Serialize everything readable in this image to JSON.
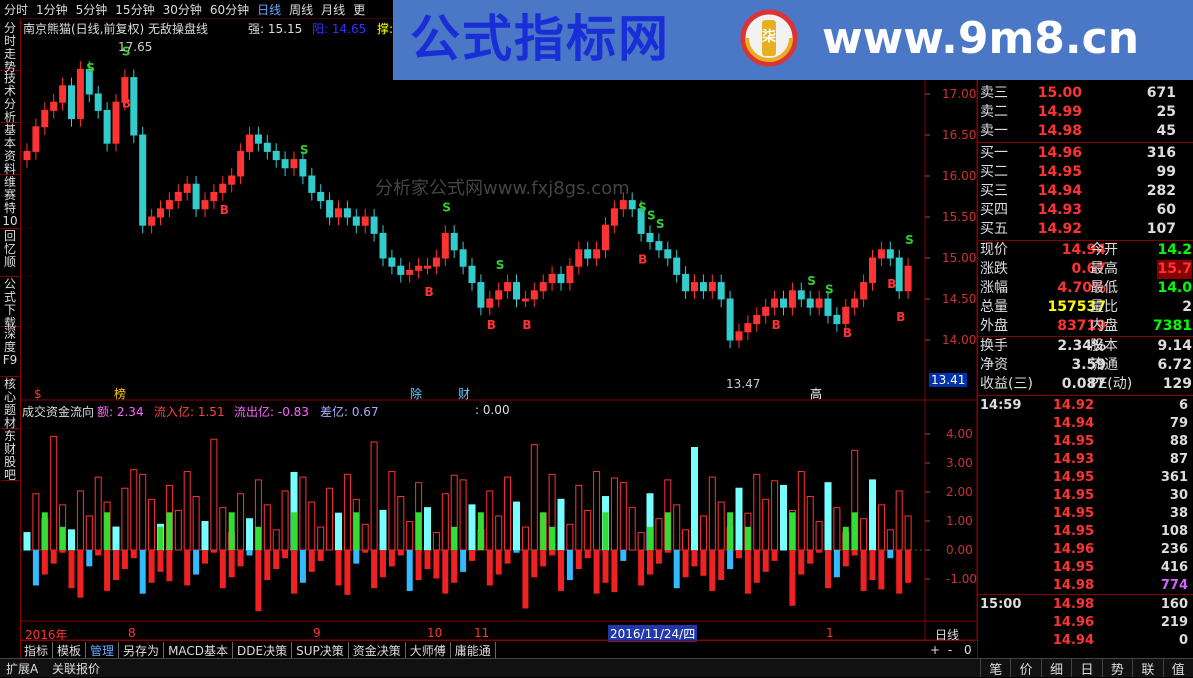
{
  "topbar": {
    "items": [
      "分时",
      "1分钟",
      "5分钟",
      "15分钟",
      "30分钟",
      "60分钟",
      "日线",
      "周线",
      "月线",
      "更"
    ],
    "active": "日线"
  },
  "lefttabs": [
    "分时走势",
    "技术分析",
    "基本资料",
    "维赛特10",
    "回忆顺",
    "公式下载",
    "深度F9",
    "核心题材",
    "东财股吧"
  ],
  "banner": {
    "left": "公式指标网",
    "right": "www.9m8.cn",
    "logo_char": "柒"
  },
  "watermark": {
    "text": "分析家公式网www.fxj8gs.com"
  },
  "chart": {
    "title": "南京熊猫(日线,前复权) 无敌操盘线",
    "legend_strong": "强: 15.15",
    "legend_yang": "阳: 14.65",
    "legend_support": "撑:",
    "price_axis": [
      "17.00",
      "16.50",
      "16.00",
      "15.50",
      "15.00",
      "14.50",
      "14.00"
    ],
    "cur_price": "13.41",
    "high_label": "17.65",
    "low_label": "13.47",
    "markers": {
      "s_label": "S",
      "b_label": "B"
    },
    "event_tags": [
      "$",
      "榜",
      "除",
      "财",
      "高"
    ],
    "sub_title": "成交资金流向",
    "sub_legend": {
      "e": "额: 2.34",
      "in": "流入亿: 1.51",
      "out": "流出亿: -0.83",
      "diff": "差亿: 0.67",
      "zero": ": 0.00"
    },
    "sub_axis": [
      "4.00",
      "3.00",
      "2.00",
      "1.00",
      "0.00",
      "-1.00"
    ],
    "date_axis": {
      "year": "2016年",
      "m8": "8",
      "m9": "9",
      "m10": "10",
      "m11": "11",
      "sel": "2016/11/24/四",
      "m1": "1"
    },
    "period": "日线",
    "zoom": [
      "+",
      "-",
      "0"
    ]
  },
  "quotes": {
    "sell": [
      {
        "k": "卖三",
        "p": "15.00",
        "q": "671"
      },
      {
        "k": "卖二",
        "p": "14.99",
        "q": "25"
      },
      {
        "k": "卖一",
        "p": "14.98",
        "q": "45"
      }
    ],
    "buy": [
      {
        "k": "买一",
        "p": "14.96",
        "q": "316"
      },
      {
        "k": "买二",
        "p": "14.95",
        "q": "99"
      },
      {
        "k": "买三",
        "p": "14.94",
        "q": "282"
      },
      {
        "k": "买四",
        "p": "14.93",
        "q": "60"
      },
      {
        "k": "买五",
        "p": "14.92",
        "q": "107"
      }
    ],
    "stats": [
      {
        "k": "现价",
        "v": "14.94",
        "k2": "今开",
        "v2": "14.2"
      },
      {
        "k": "涨跌",
        "v": "0.67",
        "k2": "最高",
        "v2": "15.7"
      },
      {
        "k": "涨幅",
        "v": "4.70%",
        "k2": "最低",
        "v2": "14.0"
      },
      {
        "k": "总量",
        "v": "157537",
        "k2": "量比",
        "v2": "2"
      },
      {
        "k": "外盘",
        "v": "83719",
        "k2": "内盘",
        "v2": "7381"
      }
    ],
    "stats2": [
      {
        "k": "换手",
        "v": "2.34%",
        "k2": "股本",
        "v2": "9.14"
      },
      {
        "k": "净资",
        "v": "3.59",
        "k2": "流通",
        "v2": "6.72"
      },
      {
        "k": "收益(三)",
        "v": "0.087",
        "k2": "PE(动)",
        "v2": "129"
      }
    ]
  },
  "ticks": {
    "t1": "14:59",
    "list1": [
      {
        "p": "14.92",
        "q": "6"
      },
      {
        "p": "14.94",
        "q": "79"
      },
      {
        "p": "14.95",
        "q": "88"
      },
      {
        "p": "14.93",
        "q": "87"
      },
      {
        "p": "14.95",
        "q": "361"
      },
      {
        "p": "14.95",
        "q": "30"
      },
      {
        "p": "14.95",
        "q": "38"
      },
      {
        "p": "14.95",
        "q": "108"
      },
      {
        "p": "14.96",
        "q": "236"
      },
      {
        "p": "14.95",
        "q": "416"
      },
      {
        "p": "14.98",
        "q": "774"
      }
    ],
    "t2": "15:00",
    "list2": [
      {
        "p": "14.98",
        "q": "160"
      },
      {
        "p": "14.96",
        "q": "219"
      },
      {
        "p": "14.94",
        "q": "0"
      }
    ]
  },
  "bottomtabs": [
    "指标",
    "模板",
    "管理",
    "另存为",
    "MACD基本",
    "DDE决策",
    "SUP决策",
    "资金决策",
    "大师傅",
    "庸能通"
  ],
  "status": {
    "a": "扩展A",
    "b": "关联报价"
  },
  "righttabs": [
    "笔",
    "价",
    "细",
    "日",
    "势",
    "联",
    "值"
  ]
}
